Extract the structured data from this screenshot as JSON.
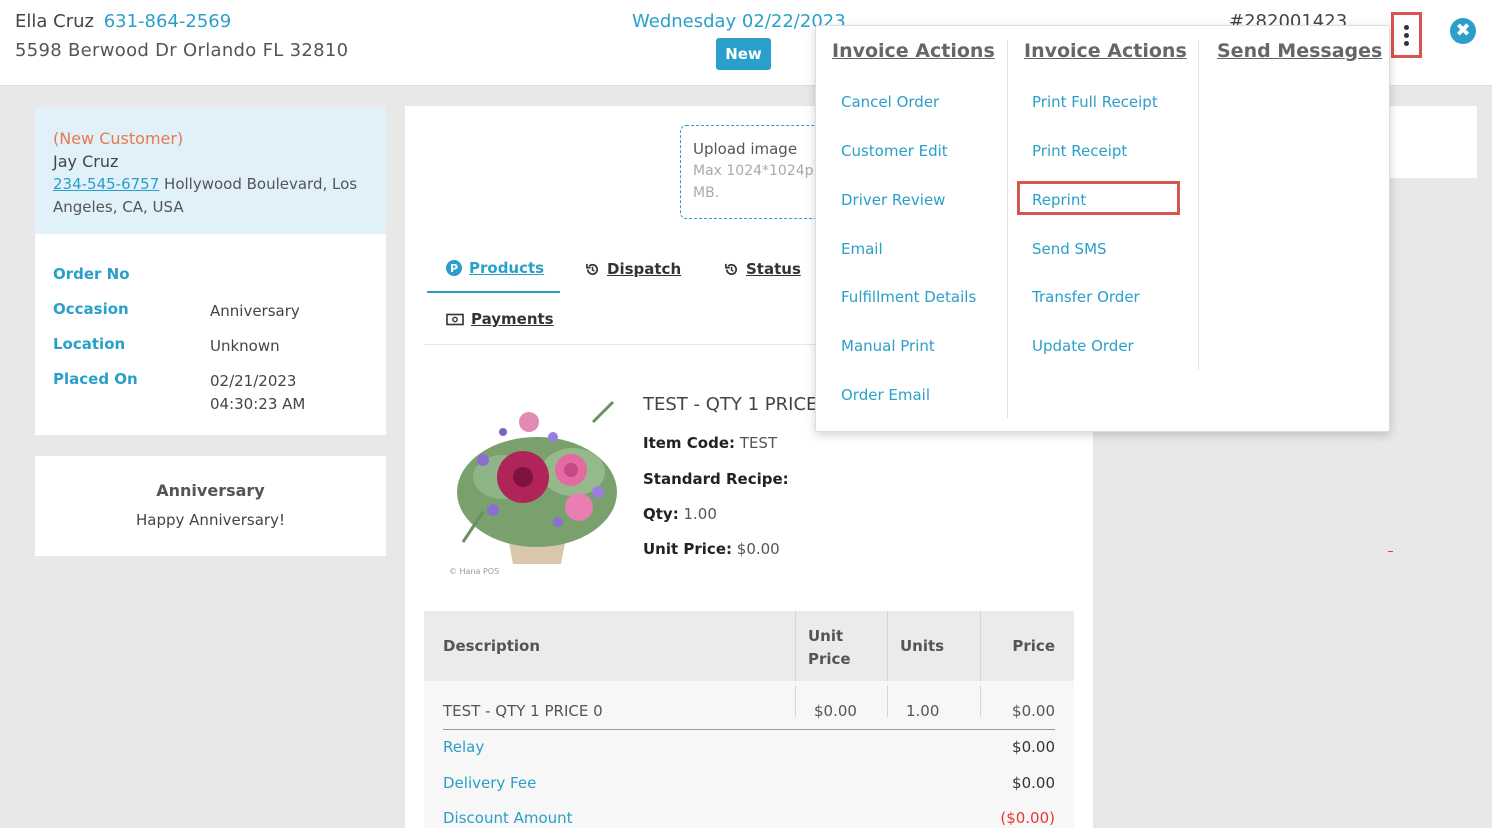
{
  "header": {
    "customer_name": "Ella Cruz",
    "customer_phone": "631-864-2569",
    "customer_address": "5598 Berwood Dr Orlando FL 32810",
    "date": "Wednesday 02/22/2023",
    "status_badge": "New",
    "order_number": "#282001423",
    "close_icon": "✖"
  },
  "customer_card": {
    "new_customer_label": "(New Customer)",
    "name": "Jay Cruz",
    "phone": "234-545-6757",
    "address_line1": " Hollywood Boulevard, Los",
    "address_line2": "Angeles, CA, USA",
    "fields": [
      {
        "label": "Order No",
        "value": ""
      },
      {
        "label": "Occasion",
        "value": "Anniversary"
      },
      {
        "label": "Location",
        "value": "Unknown"
      },
      {
        "label": "Placed On",
        "value": "02/21/2023",
        "value2": "04:30:23 AM"
      }
    ]
  },
  "occasion_card": {
    "title": "Anniversary",
    "message": "Happy Anniversary!"
  },
  "upload": {
    "title": "Upload image",
    "hint_line1": "Max 1024*1024p",
    "hint_line2": "MB."
  },
  "tabs": [
    {
      "label": "Products",
      "icon": "p-circle-icon",
      "active": true
    },
    {
      "label": "Dispatch",
      "icon": "history-icon",
      "active": false
    },
    {
      "label": "Status",
      "icon": "history-icon",
      "active": false
    },
    {
      "label": "Payments",
      "icon": "money-icon",
      "active": false
    }
  ],
  "product": {
    "title": "TEST - QTY 1 PRICE 0",
    "item_code_label": "Item Code:",
    "item_code": "TEST",
    "recipe_label": "Standard Recipe:",
    "qty_label": "Qty:",
    "qty": "1.00",
    "unit_price_label": "Unit Price:",
    "unit_price": "$0.00",
    "image_watermark": "© Hana POS"
  },
  "price_table": {
    "headers": {
      "description": "Description",
      "unit_price_1": "Unit",
      "unit_price_2": "Price",
      "units": "Units",
      "price": "Price"
    },
    "line_item": {
      "description": "TEST - QTY 1 PRICE 0",
      "unit_price": "$0.00",
      "units": "1.00",
      "price": "$0.00"
    },
    "relay_label": "Relay",
    "relay_value": "$0.00",
    "delivery_label": "Delivery Fee",
    "delivery_value": "$0.00",
    "discount_label": "Discount Amount",
    "discount_value": "($0.00)"
  },
  "dropdown": {
    "col1_title": "Invoice Actions",
    "col2_title": "Invoice Actions",
    "col3_title": "Send Messages",
    "col1_items": [
      "Cancel Order",
      "Customer Edit",
      "Driver Review",
      "Email",
      "Fulfillment Details",
      "Manual Print",
      "Order Email"
    ],
    "col2_items": [
      "Print Full Receipt",
      "Print Receipt",
      "Reprint",
      "Send SMS",
      "Transfer Order",
      "Update Order"
    ]
  },
  "colors": {
    "accent": "#2a9fc9",
    "highlight_border": "#d9534f",
    "orange": "#e57a4a",
    "negative": "#e53935"
  }
}
